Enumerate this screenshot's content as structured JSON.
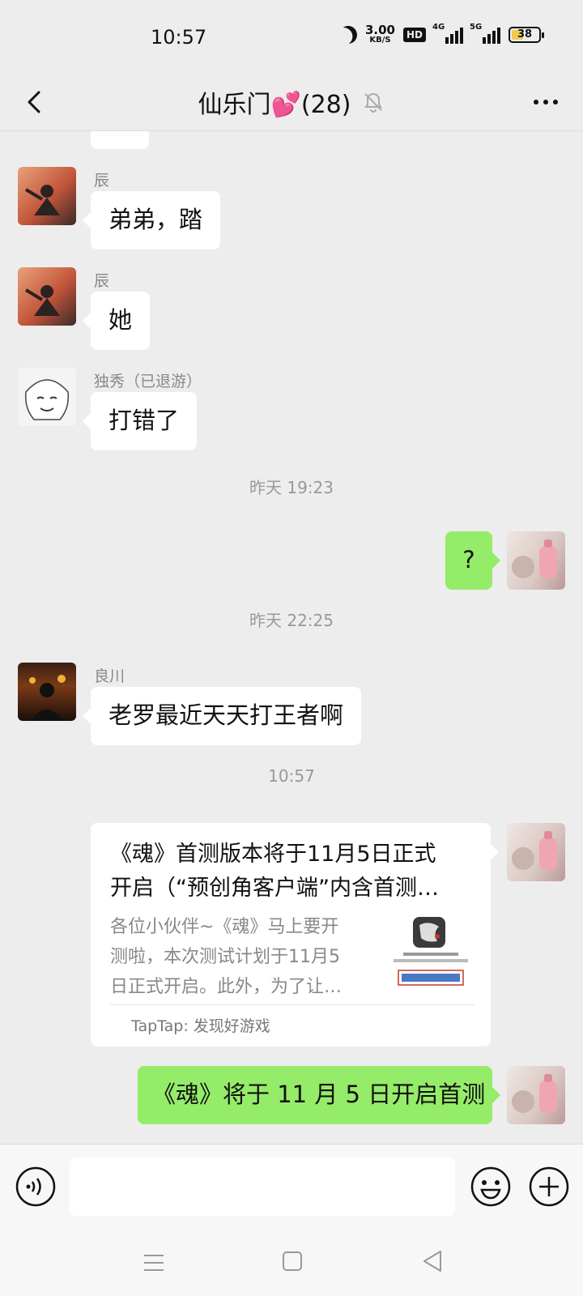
{
  "status_bar": {
    "time": "10:57",
    "speed_value": "3.00",
    "speed_unit": "KB/S",
    "hd_label": "HD",
    "net1": "4G",
    "net2": "5G",
    "battery": "38"
  },
  "header": {
    "title": "仙乐门💕(28)"
  },
  "messages": {
    "m1": {
      "sender": "辰",
      "text": "弟弟，踏"
    },
    "m2": {
      "sender": "辰",
      "text": "她"
    },
    "m3": {
      "sender": "独秀（已退游）",
      "text": "打错了"
    },
    "ts1": "昨天 19:23",
    "m4": {
      "text": "?"
    },
    "ts2": "昨天 22:25",
    "m5": {
      "sender": "良川",
      "text": "老罗最近天天打王者啊"
    },
    "ts3": "10:57",
    "card": {
      "title_line1": "《魂》首测版本将于11月5日正式",
      "title_line2": "开启（“预创角客户端”内含首测…",
      "desc_line1": "各位小伙伴~《魂》马上要开",
      "desc_line2": "测啦，本次测试计划于11月5",
      "desc_line3": "日正式开启。此外，为了让…",
      "source": "TapTap: 发现好游戏"
    },
    "m6": {
      "text": "《魂》将于 11 月 5 日开启首测"
    }
  },
  "input": {
    "placeholder": ""
  },
  "colors": {
    "background": "#ededed",
    "own_bubble": "#95ec69",
    "other_bubble": "#ffffff"
  }
}
